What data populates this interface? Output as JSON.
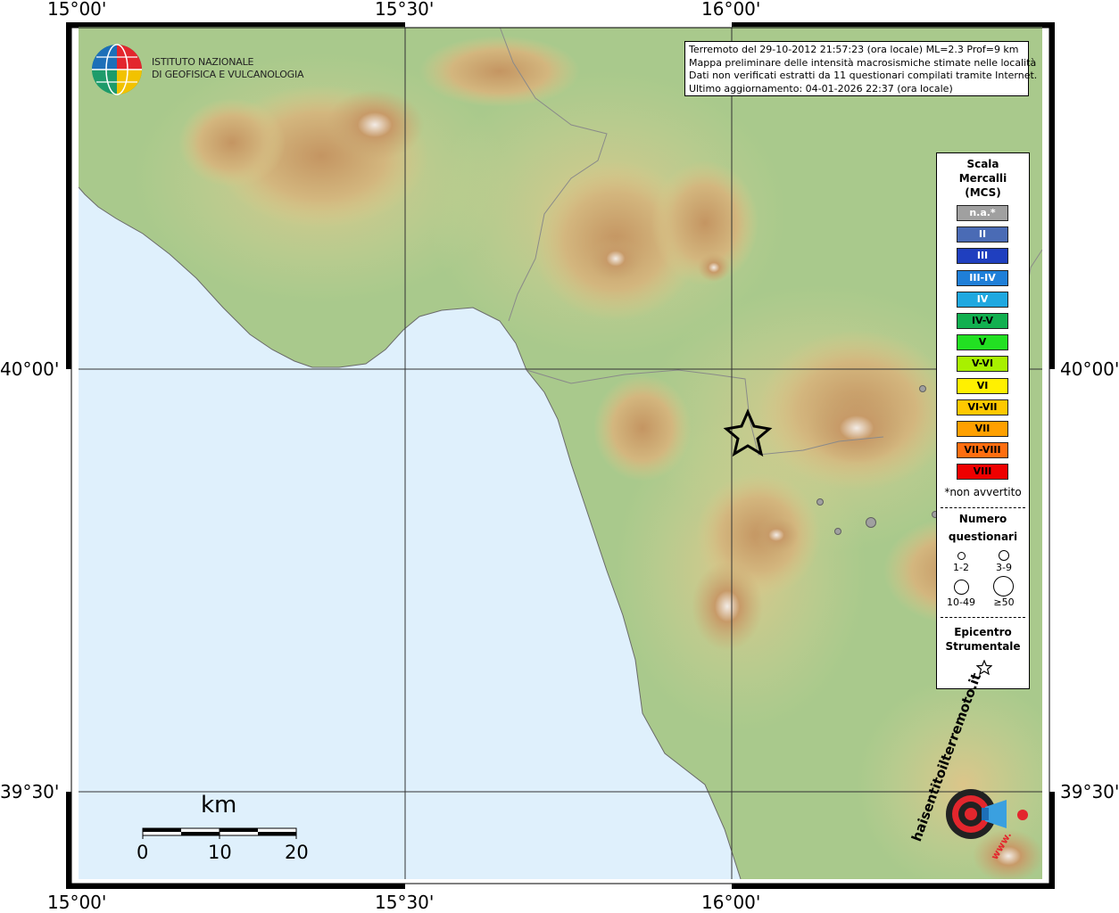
{
  "colors": {
    "sea": "#dff0fc",
    "land_low": "#a8c98a",
    "land_mid": "#d7c98a",
    "mountain": "#b98a55",
    "peak": "#efe6df"
  },
  "coords": {
    "top": [
      "15°00'",
      "15°30'",
      "16°00'"
    ],
    "bottom": [
      "15°00'",
      "15°30'",
      "16°00'"
    ],
    "left": [
      "40°00'",
      "39°30'"
    ],
    "right": [
      "40°00'",
      "39°30'"
    ]
  },
  "ingv_logo": {
    "line1": "ISTITUTO NAZIONALE",
    "line2": "DI GEOFISICA E VULCANOLOGIA"
  },
  "info": {
    "line1": "Terremoto del 29-10-2012 21:57:23 (ora locale) ML=2.3 Prof=9 km",
    "line2": "Mappa preliminare delle intensità macrosismiche stimate nelle località",
    "line3": "Dati non verificati estratti da 11 questionari compilati tramite Internet.",
    "line4": "Ultimo aggiornamento: 04-01-2026 22:37 (ora locale)"
  },
  "legend": {
    "title1": "Scala",
    "title2": "Mercalli",
    "title3": "(MCS)",
    "scale": [
      {
        "label": "n.a.*",
        "color": "#a0a0a0",
        "text_color": "#ffffff"
      },
      {
        "label": "II",
        "color": "#4a6bb5",
        "text_color": "#ffffff"
      },
      {
        "label": "III",
        "color": "#1f3fbf",
        "text_color": "#ffffff"
      },
      {
        "label": "III-IV",
        "color": "#1f7fd8",
        "text_color": "#ffffff"
      },
      {
        "label": "IV",
        "color": "#1fa8e0",
        "text_color": "#ffffff"
      },
      {
        "label": "IV-V",
        "color": "#12b050",
        "text_color": "#000000"
      },
      {
        "label": "V",
        "color": "#22e022",
        "text_color": "#000000"
      },
      {
        "label": "V-VI",
        "color": "#a8f000",
        "text_color": "#000000"
      },
      {
        "label": "VI",
        "color": "#fff000",
        "text_color": "#000000"
      },
      {
        "label": "VI-VII",
        "color": "#ffc800",
        "text_color": "#000000"
      },
      {
        "label": "VII",
        "color": "#ffa000",
        "text_color": "#000000"
      },
      {
        "label": "VII-VIII",
        "color": "#ff6e10",
        "text_color": "#000000"
      },
      {
        "label": "VIII",
        "color": "#ee0000",
        "text_color": "#000000"
      }
    ],
    "note": "*non avvertito",
    "questionari_title1": "Numero",
    "questionari_title2": "questionari",
    "q_1_2": "1-2",
    "q_3_9": "3-9",
    "q_10_49": "10-49",
    "q_50": "≥50",
    "epicentro1": "Epicentro",
    "epicentro2": "Strumentale"
  },
  "scalebar": {
    "unit": "km",
    "ticks": [
      "0",
      "10",
      "20"
    ]
  },
  "watermark": {
    "text1": "haisentitoilterremoto.it",
    "text2": "www."
  },
  "epicenter_icon": "star-icon"
}
